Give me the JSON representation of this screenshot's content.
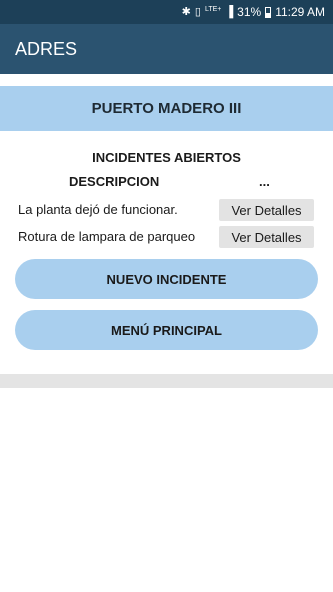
{
  "status_bar": {
    "bluetooth_icon": "bluetooth-icon",
    "vibrate_icon": "vibrate-icon",
    "network": "LTE+",
    "signal_icon": "signal-icon",
    "battery_percent": "31%",
    "battery_icon": "battery-icon",
    "time": "11:29 AM"
  },
  "app_bar": {
    "title": "ADRES"
  },
  "location": {
    "name": "PUERTO MADERO III"
  },
  "incidents": {
    "section_title": "INCIDENTES ABIERTOS",
    "col_description": "DESCRIPCION",
    "col_action": "...",
    "rows": [
      {
        "description": "La planta dejó de funcionar.",
        "action_label": "Ver Detalles"
      },
      {
        "description": "Rotura de lampara de parqueo",
        "action_label": "Ver Detalles"
      }
    ]
  },
  "actions": {
    "new_incident": "NUEVO INCIDENTE",
    "main_menu": "MENÚ PRINCIPAL"
  },
  "colors": {
    "status_bar": "#1d4058",
    "app_bar": "#2b5370",
    "accent_light_blue": "#a9cfee",
    "detail_button": "#e3e3e3"
  }
}
